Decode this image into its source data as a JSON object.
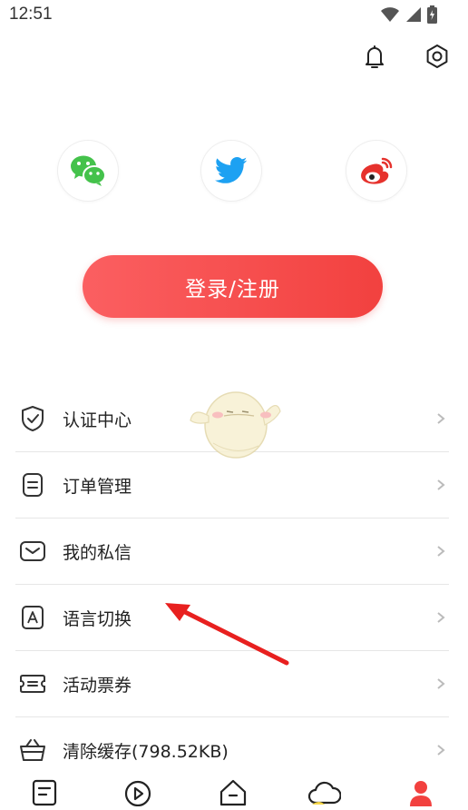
{
  "status_bar": {
    "time": "12:51"
  },
  "header": {
    "icons": [
      "bell-icon",
      "gear-icon"
    ]
  },
  "social_login": {
    "icons": [
      "wechat-icon",
      "twitter-icon",
      "weibo-icon"
    ]
  },
  "login_button": {
    "label": "登录/注册"
  },
  "menu": {
    "items": [
      {
        "label": "认证中心",
        "icon": "shield-check-icon"
      },
      {
        "label": "订单管理",
        "icon": "order-list-icon"
      },
      {
        "label": "我的私信",
        "icon": "mail-icon"
      },
      {
        "label": "语言切换",
        "icon": "language-icon"
      },
      {
        "label": "活动票券",
        "icon": "ticket-icon"
      },
      {
        "label": "清除缓存(798.52KB)",
        "icon": "basket-icon"
      }
    ]
  },
  "bottom_nav": {
    "items": [
      "list-icon",
      "play-icon",
      "home-icon",
      "cloud-icon",
      "profile-icon"
    ],
    "active": "profile-icon"
  },
  "colors": {
    "accent": "#f2413f",
    "wechat": "#44c24b",
    "twitter": "#1da1f2",
    "weibo": "#e6322d"
  }
}
